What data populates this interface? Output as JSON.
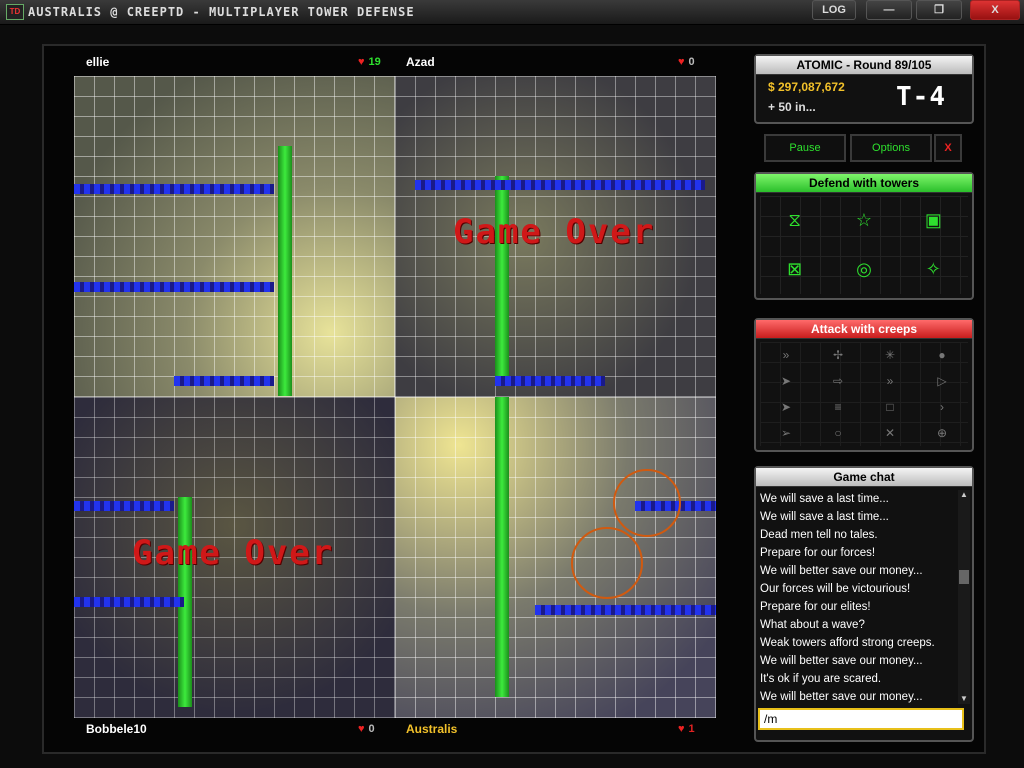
{
  "window": {
    "title": "AUSTRALIS @ CREEPTD - MULTIPLAYER TOWER DEFENSE",
    "log_label": "LOG",
    "minimize_symbol": "—",
    "maximize_symbol": "❐",
    "close_symbol": "X",
    "app_icon_text": "TD"
  },
  "players": [
    {
      "name": "ellie",
      "lives": "19",
      "lives_color": "#2ee02e"
    },
    {
      "name": "Azad",
      "lives": "0",
      "lives_color": "#bbbbbb"
    },
    {
      "name": "Bobbele10",
      "lives": "0",
      "lives_color": "#bbbbbb"
    },
    {
      "name": "Australis",
      "lives": "1",
      "lives_color": "#e22222",
      "name_color": "#f2c12a"
    }
  ],
  "map": {
    "game_over_text": "Game Over",
    "heart_symbol": "♥"
  },
  "round_panel": {
    "title": "ATOMIC - Round 89/105",
    "money": "$ 297,087,672",
    "income": "+ 50 in...",
    "timer": "T-4"
  },
  "controls": {
    "pause": "Pause",
    "options": "Options",
    "exit": "X"
  },
  "defend": {
    "title": "Defend with towers",
    "towers": [
      {
        "icon": "hourglass-tower-icon",
        "glyph": "⧖"
      },
      {
        "icon": "star-tower-icon",
        "glyph": "☆"
      },
      {
        "icon": "square-tower-icon",
        "glyph": "▣"
      },
      {
        "icon": "box-tower-icon",
        "glyph": "⊠"
      },
      {
        "icon": "ring-tower-icon",
        "glyph": "◎"
      },
      {
        "icon": "cross-tower-icon",
        "glyph": "✧"
      }
    ]
  },
  "attack": {
    "title": "Attack with creeps",
    "creeps": [
      {
        "icon": "double-chevron-creep-icon",
        "glyph": "»"
      },
      {
        "icon": "plus-creep-icon",
        "glyph": "✢"
      },
      {
        "icon": "asterisk-creep-icon",
        "glyph": "✳"
      },
      {
        "icon": "dot-creep-icon",
        "glyph": "●"
      },
      {
        "icon": "arrow-creep-icon",
        "glyph": "➤"
      },
      {
        "icon": "rocket-creep-icon",
        "glyph": "⇨"
      },
      {
        "icon": "double-chevron-creep-icon",
        "glyph": "»"
      },
      {
        "icon": "triangle-creep-icon",
        "glyph": "▷"
      },
      {
        "icon": "arrow-creep-icon",
        "glyph": "➤"
      },
      {
        "icon": "lines-creep-icon",
        "glyph": "≡"
      },
      {
        "icon": "square-creep-icon",
        "glyph": "□"
      },
      {
        "icon": "small-arrow-creep-icon",
        "glyph": "›"
      },
      {
        "icon": "dart-creep-icon",
        "glyph": "➢"
      },
      {
        "icon": "circle-creep-icon",
        "glyph": "○"
      },
      {
        "icon": "x-creep-icon",
        "glyph": "✕"
      },
      {
        "icon": "target-creep-icon",
        "glyph": "⊕"
      }
    ]
  },
  "chat": {
    "title": "Game chat",
    "messages": [
      "We will save a last time...",
      "We will save a last time...",
      "Dead men tell no tales.",
      "Prepare for our forces!",
      "We will better save our money...",
      "Our forces will be victourious!",
      "Prepare for our elites!",
      "What about a wave?",
      "Weak towers afford strong creeps.",
      "We will better save our money...",
      "It's ok if you are scared.",
      "We will better save our money..."
    ],
    "input_value": "/m"
  },
  "colors": {
    "accent_green": "#2ee02e",
    "money_gold": "#f2c12a",
    "alert_red": "#d01818"
  }
}
